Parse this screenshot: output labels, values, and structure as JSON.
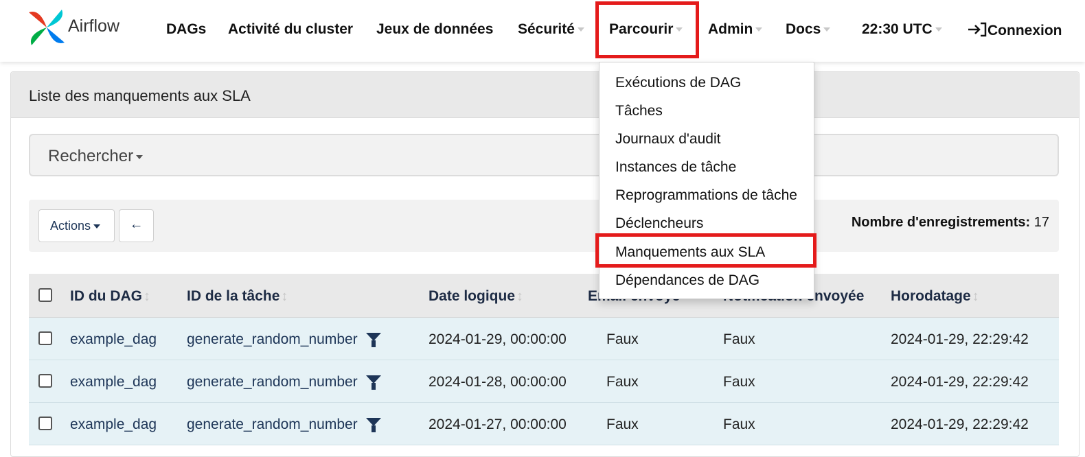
{
  "brand": {
    "name": "Airflow",
    "colors": [
      "#e43921",
      "#00c7d4",
      "#017cee",
      "#00ad46"
    ]
  },
  "nav": {
    "dags": "DAGs",
    "cluster_activity": "Activité du cluster",
    "datasets": "Jeux de données",
    "security": "Sécurité",
    "browse": "Parcourir",
    "admin": "Admin",
    "docs": "Docs",
    "time": "22:30 UTC",
    "login": "Connexion"
  },
  "browse_menu": {
    "items": [
      "Exécutions de DAG",
      "Tâches",
      "Journaux d'audit",
      "Instances de tâche",
      "Reprogrammations de tâche",
      "Déclencheurs",
      "Manquements aux SLA",
      "Dépendances de DAG"
    ],
    "highlighted": "Manquements aux SLA"
  },
  "panel": {
    "title": "Liste des manquements aux SLA"
  },
  "search": {
    "label": "Rechercher"
  },
  "actions": {
    "label": "Actions",
    "back_icon": "arrow-left-icon"
  },
  "record_count": {
    "label": "Nombre d'enregistrements:",
    "value": "17"
  },
  "table": {
    "columns": [
      "ID du DAG",
      "ID de la tâche",
      "Date logique",
      "Email envoyé",
      "Notification envoyée",
      "Horodatage"
    ],
    "rows": [
      [
        "example_dag",
        "generate_random_number",
        "2024-01-29, 00:00:00",
        "Faux",
        "Faux",
        "2024-01-29, 22:29:42"
      ],
      [
        "example_dag",
        "generate_random_number",
        "2024-01-28, 00:00:00",
        "Faux",
        "Faux",
        "2024-01-29, 22:29:42"
      ],
      [
        "example_dag",
        "generate_random_number",
        "2024-01-27, 00:00:00",
        "Faux",
        "Faux",
        "2024-01-29, 22:29:42"
      ]
    ]
  },
  "annotation_color": "#e41b1b"
}
